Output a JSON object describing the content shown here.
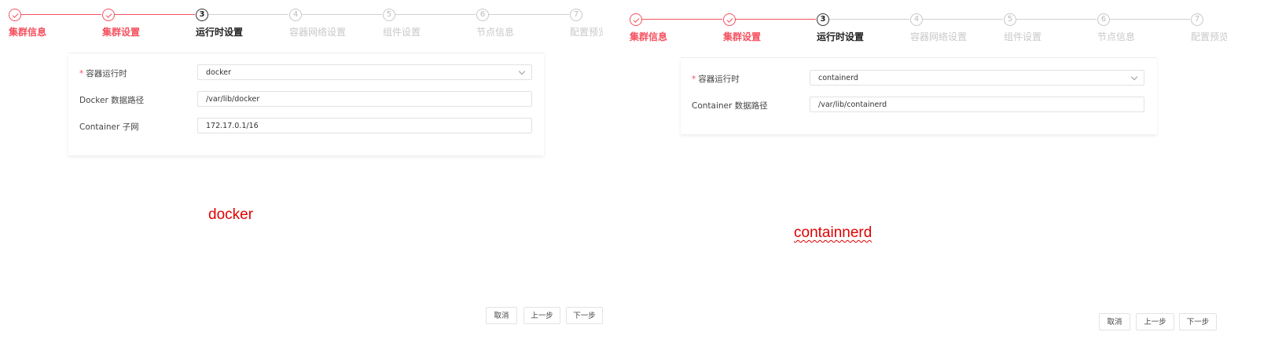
{
  "left": {
    "steps": [
      {
        "number": "1",
        "label": "集群信息",
        "state": "done"
      },
      {
        "number": "2",
        "label": "集群设置",
        "state": "done"
      },
      {
        "number": "3",
        "label": "运行时设置",
        "state": "active"
      },
      {
        "number": "4",
        "label": "容器网络设置",
        "state": "pending"
      },
      {
        "number": "5",
        "label": "组件设置",
        "state": "pending"
      },
      {
        "number": "6",
        "label": "节点信息",
        "state": "pending"
      },
      {
        "number": "7",
        "label": "配置预览",
        "state": "pending"
      }
    ],
    "form": {
      "runtime": {
        "required_mark": "*",
        "label": "容器运行时",
        "value": "docker"
      },
      "data_path": {
        "label": "Docker 数据路径",
        "value": "/var/lib/docker"
      },
      "subnet": {
        "label": "Container 子网",
        "value": "172.17.0.1/16"
      }
    },
    "caption": "docker",
    "buttons": {
      "cancel": "取消",
      "prev": "上一步",
      "next": "下一步"
    }
  },
  "right": {
    "steps": [
      {
        "number": "1",
        "label": "集群信息",
        "state": "done"
      },
      {
        "number": "2",
        "label": "集群设置",
        "state": "done"
      },
      {
        "number": "3",
        "label": "运行时设置",
        "state": "active"
      },
      {
        "number": "4",
        "label": "容器网络设置",
        "state": "pending"
      },
      {
        "number": "5",
        "label": "组件设置",
        "state": "pending"
      },
      {
        "number": "6",
        "label": "节点信息",
        "state": "pending"
      },
      {
        "number": "7",
        "label": "配置预览",
        "state": "pending"
      }
    ],
    "form": {
      "runtime": {
        "required_mark": "*",
        "label": "容器运行时",
        "value": "containerd"
      },
      "data_path": {
        "label": "Container 数据路径",
        "value": "/var/lib/containerd"
      }
    },
    "caption": "containnerd",
    "buttons": {
      "cancel": "取消",
      "prev": "上一步",
      "next": "下一步"
    }
  },
  "colors": {
    "accent": "#f5515f",
    "caption": "#e00000"
  }
}
